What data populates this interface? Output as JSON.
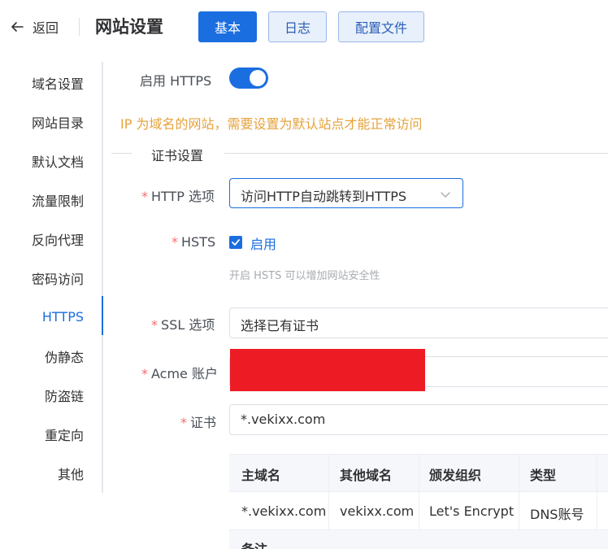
{
  "header": {
    "back_label": "返回",
    "title": "网站设置",
    "tabs": [
      {
        "label": "基本",
        "active": true
      },
      {
        "label": "日志",
        "active": false
      },
      {
        "label": "配置文件",
        "active": false
      }
    ]
  },
  "sidebar": {
    "items": [
      {
        "label": "域名设置",
        "active": false
      },
      {
        "label": "网站目录",
        "active": false
      },
      {
        "label": "默认文档",
        "active": false
      },
      {
        "label": "流量限制",
        "active": false
      },
      {
        "label": "反向代理",
        "active": false
      },
      {
        "label": "密码访问",
        "active": false
      },
      {
        "label": "HTTPS",
        "active": true
      },
      {
        "label": "伪静态",
        "active": false
      },
      {
        "label": "防盗链",
        "active": false
      },
      {
        "label": "重定向",
        "active": false
      },
      {
        "label": "其他",
        "active": false
      }
    ]
  },
  "form": {
    "enable_https": {
      "label": "启用 HTTPS",
      "enabled": true
    },
    "warning": "IP 为域名的网站，需要设置为默认站点才能正常访问",
    "cert_section_title": "证书设置",
    "http_option": {
      "required": "*",
      "label": "HTTP 选项",
      "value": "访问HTTP自动跳转到HTTPS"
    },
    "hsts": {
      "required": "*",
      "label": "HSTS",
      "checked": true,
      "check_label": "启用",
      "hint": "开启 HSTS 可以增加网站安全性"
    },
    "ssl_option": {
      "required": "*",
      "label": "SSL 选项",
      "value": "选择已有证书"
    },
    "acme_account": {
      "required": "*",
      "label": "Acme 账户"
    },
    "certificate": {
      "required": "*",
      "label": "证书",
      "value": "*.vekixx.com"
    }
  },
  "cert_table": {
    "columns": [
      "主域名",
      "其他域名",
      "颁发组织",
      "类型"
    ],
    "rows": [
      [
        "*.vekixx.com",
        "vekixx.com",
        "Let's Encrypt",
        "DNS账号"
      ]
    ],
    "remark_label": "备注"
  },
  "colors": {
    "primary": "#1b6ee0",
    "warning": "#e6a23c",
    "required": "#f56c6c",
    "redaction": "#ed1c24"
  },
  "icons": {
    "back": "arrow-left-icon",
    "select": "chevron-down-icon",
    "checkbox": "check-icon"
  }
}
